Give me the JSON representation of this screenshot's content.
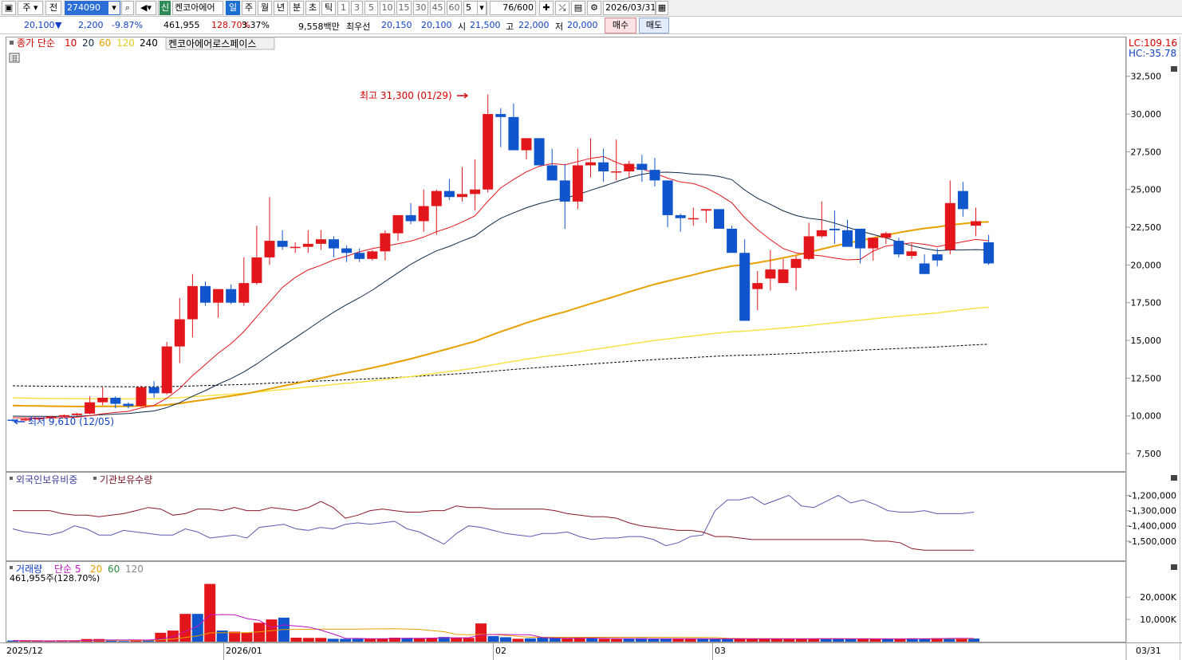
{
  "toolbar": {
    "period_label": "주",
    "prev_label": "전",
    "stock_code": "274090",
    "new_badge": "신",
    "stock_name": "켄코아에어",
    "periods": [
      "일",
      "주",
      "월",
      "년",
      "분",
      "초",
      "틱"
    ],
    "active_period": "일",
    "interval_buttons": [
      "1",
      "3",
      "5",
      "10",
      "15",
      "30",
      "45",
      "60"
    ],
    "interval_value": "5",
    "count_value": "76",
    "count_max": "/600",
    "date_value": "2026/03/31"
  },
  "quote": {
    "price": "20,100",
    "direction": "▼",
    "change": "2,200",
    "change_pct": "-9.87%",
    "volume": "461,955",
    "volume_ratio": "128.70%",
    "turnover": "3.37%",
    "amount": "9,558백만",
    "best_bid_label": "최우선",
    "best_bid": "20,150",
    "best_ask": "20,100",
    "open_label": "시",
    "open": "21,500",
    "high_label": "고",
    "high": "22,000",
    "low_label": "저",
    "low": "20,000",
    "buy_label": "매수",
    "sell_label": "매도"
  },
  "price_panel": {
    "legend_title": "종가 단순",
    "ma_labels": [
      "10",
      "20",
      "60",
      "120",
      "240"
    ],
    "stock_tag": "켄코아에어로스페이스",
    "lc_label": "LC:109.16",
    "hc_label": "HC:-35.78",
    "high_annotation": "최고 31,300 (01/29)",
    "low_annotation": "최저 9,610 (12/05)"
  },
  "holdings_panel": {
    "legend_foreign": "외국인보유비중",
    "legend_inst": "기관보유수량"
  },
  "volume_panel": {
    "legend_title": "거래량",
    "legend_ma": "단순 5",
    "ma_labels": [
      "20",
      "60",
      "120"
    ],
    "current_volume": "461,955주(128.70%)"
  },
  "x_axis": {
    "labels": [
      "2025/12",
      "2026/01",
      "02",
      "03"
    ],
    "right_label": "03/31"
  },
  "colors": {
    "up": "#e3161b",
    "down": "#1155cc",
    "ma10": "#e3161b",
    "ma20": "#0e2a4a",
    "ma60": "#e8a000",
    "ma120": "#f5e23a",
    "ma240": "#000000"
  },
  "chart_data": [
    {
      "type": "candlestick",
      "title": "",
      "y_axis_ticks": [
        "32,500",
        "30,000",
        "27,500",
        "25,000",
        "22,500",
        "20,000",
        "17,500",
        "15,000",
        "12,500",
        "10,000",
        "7,500"
      ],
      "ylim": [
        6500,
        33700
      ],
      "x_range_label": "2025/12 - 2026/03/31",
      "candles": [
        [
          9750,
          9800,
          9610,
          9700
        ],
        [
          9700,
          9850,
          9650,
          9800
        ],
        [
          9800,
          9900,
          9700,
          9850
        ],
        [
          9850,
          10000,
          9800,
          9950
        ],
        [
          9950,
          10100,
          9850,
          10050
        ],
        [
          10050,
          10200,
          10000,
          10150
        ],
        [
          10150,
          11300,
          10100,
          10900
        ],
        [
          10900,
          11900,
          10700,
          11200
        ],
        [
          11200,
          11300,
          10500,
          10800
        ],
        [
          10800,
          10900,
          10500,
          10650
        ],
        [
          10650,
          12000,
          10600,
          11900
        ],
        [
          11900,
          12300,
          11200,
          11500
        ],
        [
          11500,
          14900,
          11400,
          14600
        ],
        [
          14600,
          17800,
          13500,
          16400
        ],
        [
          16400,
          19400,
          15200,
          18600
        ],
        [
          18600,
          18900,
          17300,
          17500
        ],
        [
          17500,
          18300,
          16500,
          18400
        ],
        [
          18400,
          18700,
          17400,
          17500
        ],
        [
          17500,
          20500,
          17300,
          18800
        ],
        [
          18800,
          22600,
          18700,
          20500
        ],
        [
          20500,
          24500,
          20000,
          21600
        ],
        [
          21600,
          22300,
          21000,
          21200
        ],
        [
          21200,
          21500,
          20800,
          21200
        ],
        [
          21200,
          22300,
          20800,
          21400
        ],
        [
          21400,
          22300,
          21000,
          21700
        ],
        [
          21700,
          21900,
          20500,
          21100
        ],
        [
          21100,
          21300,
          20200,
          20800
        ],
        [
          20800,
          21100,
          20200,
          20400
        ],
        [
          20400,
          21000,
          20300,
          20900
        ],
        [
          20900,
          22300,
          20300,
          22100
        ],
        [
          22100,
          23300,
          21600,
          23300
        ],
        [
          23300,
          24100,
          22700,
          22900
        ],
        [
          22900,
          25000,
          22200,
          23900
        ],
        [
          23900,
          25000,
          22000,
          24900
        ],
        [
          24900,
          25700,
          24300,
          24500
        ],
        [
          24500,
          26500,
          24200,
          24700
        ],
        [
          24700,
          27000,
          23600,
          25000
        ],
        [
          25000,
          31300,
          24800,
          30000
        ],
        [
          30000,
          30400,
          27800,
          29800
        ],
        [
          29800,
          30700,
          27600,
          27600
        ],
        [
          27600,
          28000,
          27000,
          28400
        ],
        [
          28400,
          28400,
          26700,
          26600
        ],
        [
          26600,
          27700,
          25900,
          25600
        ],
        [
          25600,
          26700,
          22400,
          24200
        ],
        [
          24200,
          27700,
          23700,
          26600
        ],
        [
          26600,
          28400,
          25800,
          26800
        ],
        [
          26800,
          27700,
          25500,
          26200
        ],
        [
          26200,
          28300,
          25600,
          26200
        ],
        [
          26200,
          26900,
          25800,
          26700
        ],
        [
          26700,
          27300,
          25500,
          26300
        ],
        [
          26300,
          27100,
          25200,
          25600
        ],
        [
          25600,
          25600,
          22500,
          23300
        ],
        [
          23300,
          23400,
          22200,
          23100
        ],
        [
          23100,
          23800,
          22600,
          23100
        ],
        [
          23600,
          23700,
          22800,
          23700
        ],
        [
          23700,
          23600,
          22700,
          22400
        ],
        [
          22400,
          22600,
          20800,
          20800
        ],
        [
          20800,
          21700,
          17400,
          16300
        ],
        [
          18400,
          19600,
          17000,
          18800
        ],
        [
          19100,
          21000,
          18300,
          19700
        ],
        [
          18800,
          20400,
          19300,
          19700
        ],
        [
          19800,
          20600,
          18300,
          20400
        ],
        [
          20400,
          22800,
          20300,
          21900
        ],
        [
          21900,
          24200,
          21800,
          22300
        ],
        [
          22400,
          23600,
          21400,
          22300
        ],
        [
          22300,
          23000,
          21700,
          21200
        ],
        [
          22400,
          21900,
          20100,
          21100
        ],
        [
          21100,
          21600,
          20300,
          21800
        ],
        [
          21800,
          22200,
          21400,
          22100
        ],
        [
          21600,
          21800,
          20500,
          20700
        ],
        [
          20600,
          21400,
          20400,
          20900
        ],
        [
          20100,
          20700,
          19400,
          19400
        ],
        [
          20700,
          21100,
          19900,
          20300
        ],
        [
          21000,
          25600,
          20700,
          24100
        ],
        [
          24900,
          25500,
          23200,
          23700
        ],
        [
          22600,
          23800,
          21900,
          22900
        ],
        [
          21500,
          22000,
          20000,
          20100
        ]
      ]
    },
    {
      "type": "line",
      "title": "",
      "y_axis_ticks": [
        "-1,200,000",
        "-1,300,000",
        "-1,400,000",
        "-1,500,000"
      ],
      "ylim": [
        -1600000,
        -1130000
      ],
      "series": [
        {
          "name": "외국인보유비중",
          "values": [
            -1420000,
            -1440000,
            -1450000,
            -1460000,
            -1440000,
            -1400000,
            -1420000,
            -1460000,
            -1460000,
            -1430000,
            -1440000,
            -1450000,
            -1460000,
            -1460000,
            -1420000,
            -1440000,
            -1480000,
            -1470000,
            -1460000,
            -1480000,
            -1410000,
            -1400000,
            -1390000,
            -1420000,
            -1430000,
            -1410000,
            -1420000,
            -1390000,
            -1380000,
            -1390000,
            -1380000,
            -1370000,
            -1420000,
            -1440000,
            -1480000,
            -1520000,
            -1450000,
            -1400000,
            -1410000,
            -1430000,
            -1450000,
            -1460000,
            -1470000,
            -1450000,
            -1450000,
            -1440000,
            -1470000,
            -1490000,
            -1480000,
            -1480000,
            -1470000,
            -1470000,
            -1490000,
            -1530000,
            -1510000,
            -1470000,
            -1460000,
            -1300000,
            -1230000,
            -1230000,
            -1210000,
            -1260000,
            -1230000,
            -1200000,
            -1270000,
            -1280000,
            -1240000,
            -1200000,
            -1250000,
            -1230000,
            -1260000,
            -1300000,
            -1310000,
            -1310000,
            -1300000,
            -1320000,
            -1320000,
            -1320000,
            -1310000
          ]
        },
        {
          "name": "기관보유수량",
          "values": [
            -1300000,
            -1300000,
            -1300000,
            -1300000,
            -1320000,
            -1330000,
            -1330000,
            -1340000,
            -1330000,
            -1320000,
            -1300000,
            -1280000,
            -1290000,
            -1330000,
            -1320000,
            -1290000,
            -1290000,
            -1300000,
            -1280000,
            -1300000,
            -1300000,
            -1280000,
            -1290000,
            -1300000,
            -1280000,
            -1240000,
            -1280000,
            -1350000,
            -1330000,
            -1300000,
            -1290000,
            -1300000,
            -1310000,
            -1310000,
            -1300000,
            -1300000,
            -1270000,
            -1280000,
            -1280000,
            -1290000,
            -1290000,
            -1290000,
            -1290000,
            -1290000,
            -1300000,
            -1320000,
            -1330000,
            -1340000,
            -1340000,
            -1350000,
            -1380000,
            -1400000,
            -1410000,
            -1420000,
            -1430000,
            -1430000,
            -1440000,
            -1470000,
            -1470000,
            -1480000,
            -1490000,
            -1490000,
            -1490000,
            -1490000,
            -1490000,
            -1490000,
            -1490000,
            -1490000,
            -1490000,
            -1490000,
            -1500000,
            -1500000,
            -1510000,
            -1550000,
            -1560000,
            -1560000,
            -1560000,
            -1560000,
            -1560000
          ]
        }
      ]
    },
    {
      "type": "bar",
      "title": "",
      "y_axis_ticks": [
        "20,000K",
        "10,000K"
      ],
      "ylim": [
        0,
        33000
      ],
      "values": [
        500,
        400,
        300,
        300,
        400,
        500,
        1200,
        1200,
        500,
        300,
        800,
        700,
        4000,
        5000,
        12500,
        12500,
        26000,
        5000,
        4500,
        4000,
        8500,
        10000,
        10800,
        1800,
        1700,
        1700,
        1300,
        1300,
        1300,
        1300,
        1400,
        1800,
        1700,
        1600,
        1600,
        2100,
        1700,
        1700,
        8200,
        2500,
        2000,
        1300,
        1500,
        1800,
        1600,
        1500,
        1700,
        1500,
        1300,
        1200,
        1300,
        1600,
        1400,
        1300,
        1300,
        1300,
        1300,
        1300,
        1300,
        1300,
        1300,
        1300,
        1300,
        1300,
        1300,
        1400,
        1300,
        1300,
        1200,
        1300,
        1200,
        1200,
        1200,
        1500,
        1400,
        1600,
        1600,
        1400,
        1400
      ]
    }
  ]
}
